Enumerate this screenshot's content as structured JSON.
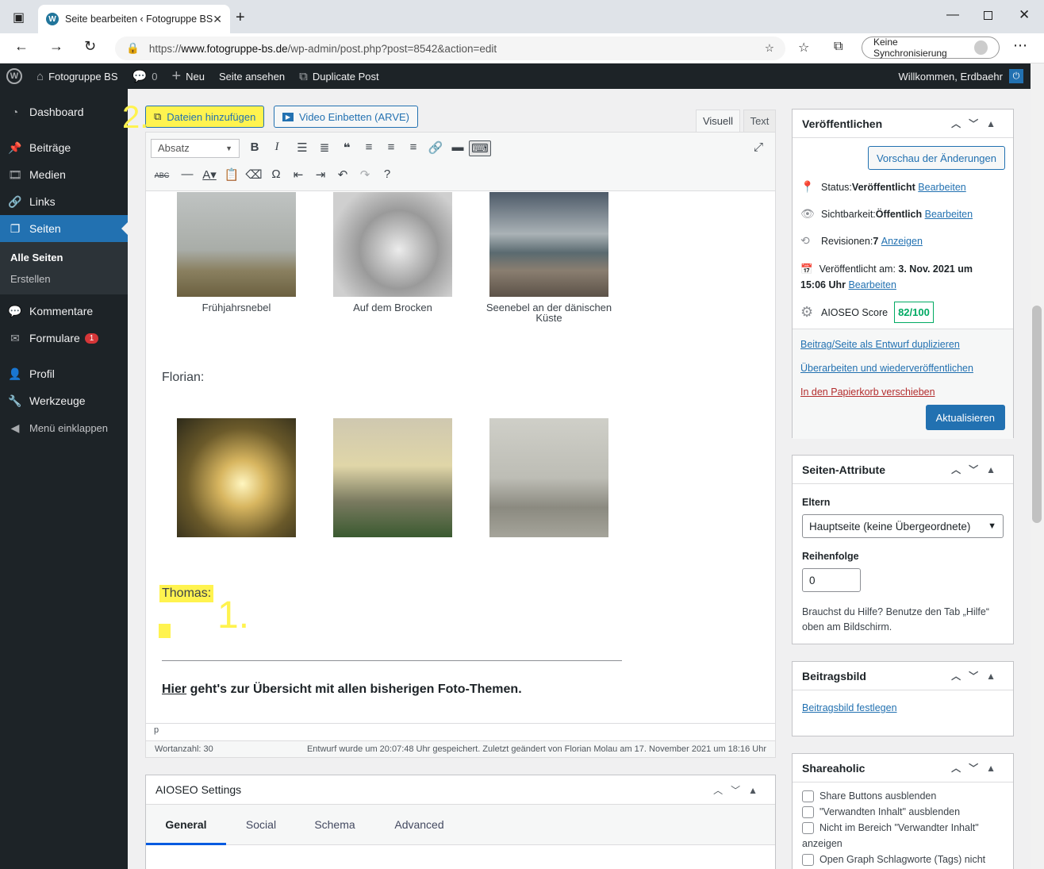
{
  "browser": {
    "tab_title": "Seite bearbeiten ‹ Fotogruppe BS",
    "url_prefix": "https://",
    "url_domain": "www.fotogruppe-bs.de",
    "url_path": "/wp-admin/post.php?post=8542&action=edit",
    "sync_label": "Keine Synchronisierung"
  },
  "adminbar": {
    "site_name": "Fotogruppe BS",
    "comments_count": "0",
    "new_label": "Neu",
    "view_page": "Seite ansehen",
    "duplicate": "Duplicate Post",
    "welcome": "Willkommen, Erdbaehr"
  },
  "sidebar": {
    "items": [
      {
        "label": "Dashboard"
      },
      {
        "label": "Beiträge"
      },
      {
        "label": "Medien"
      },
      {
        "label": "Links"
      },
      {
        "label": "Seiten"
      },
      {
        "label": "Kommentare"
      },
      {
        "label": "Formulare",
        "badge": "1"
      },
      {
        "label": "Profil"
      },
      {
        "label": "Werkzeuge"
      },
      {
        "label": "Menü einklappen"
      }
    ],
    "submenu": [
      "Alle Seiten",
      "Erstellen"
    ]
  },
  "editor": {
    "add_media": "Dateien hinzufügen",
    "embed_video": "Video Einbetten (ARVE)",
    "tab_visual": "Visuell",
    "tab_text": "Text",
    "format_select": "Absatz",
    "captions": [
      "Frühjahrsnebel",
      "Auf dem Brocken",
      "Seenebel an der dänischen Küste"
    ],
    "florian": "Florian:",
    "thomas": "Thomas:",
    "annot_1": "1.",
    "annot_2": "2.",
    "link_word": "Hier",
    "link_rest": " geht's zur Übersicht mit allen bisherigen Foto-Themen.",
    "path": "p",
    "word_count": "Wortanzahl: 30",
    "status_line": "Entwurf wurde um 20:07:48 Uhr gespeichert. Zuletzt geändert von Florian Molau am 17. November 2021 um 18:16 Uhr"
  },
  "aioseo": {
    "title": "AIOSEO Settings",
    "tabs": [
      "General",
      "Social",
      "Schema",
      "Advanced"
    ]
  },
  "publish": {
    "title": "Veröffentlichen",
    "preview": "Vorschau der Änderungen",
    "status_label": "Status: ",
    "status_value": "Veröffentlicht",
    "visibility_label": "Sichtbarkeit: ",
    "visibility_value": "Öffentlich",
    "revisions_label": "Revisionen: ",
    "revisions_value": "7",
    "revisions_link": "Anzeigen",
    "published_label": "Veröffentlicht am: ",
    "published_value_1": "3. Nov. 2021 um",
    "published_value_2": "15:06 Uhr",
    "edit": "Bearbeiten",
    "aioseo_score_label": "AIOSEO Score",
    "aioseo_score": "82/100",
    "dup_link": "Beitrag/Seite als Entwurf duplizieren",
    "rewrite_link": "Überarbeiten und wiederveröffentlichen",
    "trash_link": "In den Papierkorb verschieben",
    "update": "Aktualisieren"
  },
  "attributes": {
    "title": "Seiten-Attribute",
    "parent_label": "Eltern",
    "parent_value": "Hauptseite (keine Übergeordnete)",
    "order_label": "Reihenfolge",
    "order_value": "0",
    "help": "Brauchst du Hilfe? Benutze den Tab „Hilfe“ oben am Bildschirm."
  },
  "featured": {
    "title": "Beitragsbild",
    "set_link": "Beitragsbild festlegen"
  },
  "shareaholic": {
    "title": "Shareaholic",
    "options": [
      "Share Buttons ausblenden",
      "\"Verwandten Inhalt\" ausblenden",
      "Nicht im Bereich \"Verwandter Inhalt\" anzeigen",
      "Open Graph Schlagworte (Tags) nicht"
    ]
  },
  "colors": {
    "accent": "#2271b1",
    "highlight": "#fff34f",
    "adminbar": "#1d2327",
    "score": "#00aa63",
    "trash": "#b32d2e"
  }
}
